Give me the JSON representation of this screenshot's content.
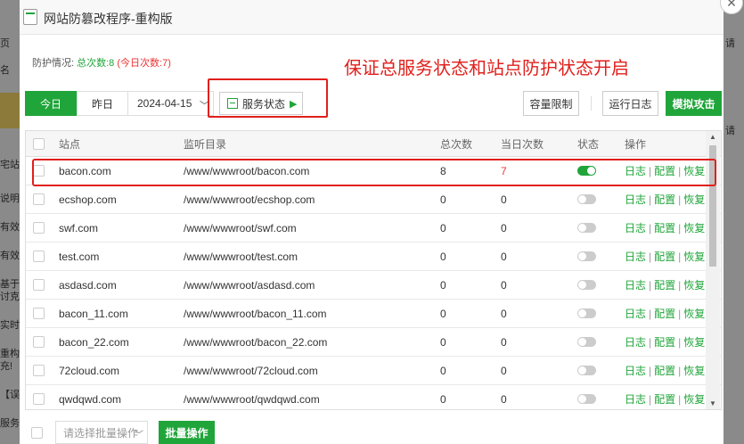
{
  "background": {
    "left_fragments": [
      "页",
      "名",
      "宅站",
      "说明",
      "有效",
      "有效",
      "基于",
      "讨克",
      "实时",
      "重构",
      "充!",
      "【误",
      "服务"
    ],
    "right_fragments": [
      "请",
      "请"
    ]
  },
  "dialog": {
    "title": "网站防篡改程序-重构版",
    "close_glyph": "✕"
  },
  "status": {
    "label": "防护情况:",
    "total": "总次数:8",
    "today": "(今日次数:7)"
  },
  "annotation": "保证总服务状态和站点防护状态开启",
  "toolbar": {
    "today": "今日",
    "yesterday": "昨日",
    "date": "2024-04-15",
    "service_status": "服务状态",
    "capacity_limit": "容量限制",
    "run_log": "运行日志",
    "simulate_attack": "模拟攻击"
  },
  "table": {
    "headers": {
      "site": "站点",
      "dir": "监听目录",
      "total": "总次数",
      "today": "当日次数",
      "state": "状态",
      "op": "操作"
    },
    "op_labels": {
      "log": "日志",
      "config": "配置",
      "restore": "恢复",
      "sep": "|"
    },
    "rows": [
      {
        "site": "bacon.com",
        "dir": "/www/wwwroot/bacon.com",
        "total": "8",
        "today": "7",
        "on": true
      },
      {
        "site": "ecshop.com",
        "dir": "/www/wwwroot/ecshop.com",
        "total": "0",
        "today": "0",
        "on": false
      },
      {
        "site": "swf.com",
        "dir": "/www/wwwroot/swf.com",
        "total": "0",
        "today": "0",
        "on": false
      },
      {
        "site": "test.com",
        "dir": "/www/wwwroot/test.com",
        "total": "0",
        "today": "0",
        "on": false
      },
      {
        "site": "asdasd.com",
        "dir": "/www/wwwroot/asdasd.com",
        "total": "0",
        "today": "0",
        "on": false
      },
      {
        "site": "bacon_11.com",
        "dir": "/www/wwwroot/bacon_11.com",
        "total": "0",
        "today": "0",
        "on": false
      },
      {
        "site": "bacon_22.com",
        "dir": "/www/wwwroot/bacon_22.com",
        "total": "0",
        "today": "0",
        "on": false
      },
      {
        "site": "72cloud.com",
        "dir": "/www/wwwroot/72cloud.com",
        "total": "0",
        "today": "0",
        "on": false
      },
      {
        "site": "qwdqwd.com",
        "dir": "/www/wwwroot/qwdqwd.com",
        "total": "0",
        "today": "0",
        "on": false
      }
    ]
  },
  "bottom": {
    "batch_placeholder": "请选择批量操作",
    "batch_button": "批量操作"
  },
  "colors": {
    "accent": "#20a53a",
    "alert": "#e33333",
    "annotation": "#e0201c"
  }
}
